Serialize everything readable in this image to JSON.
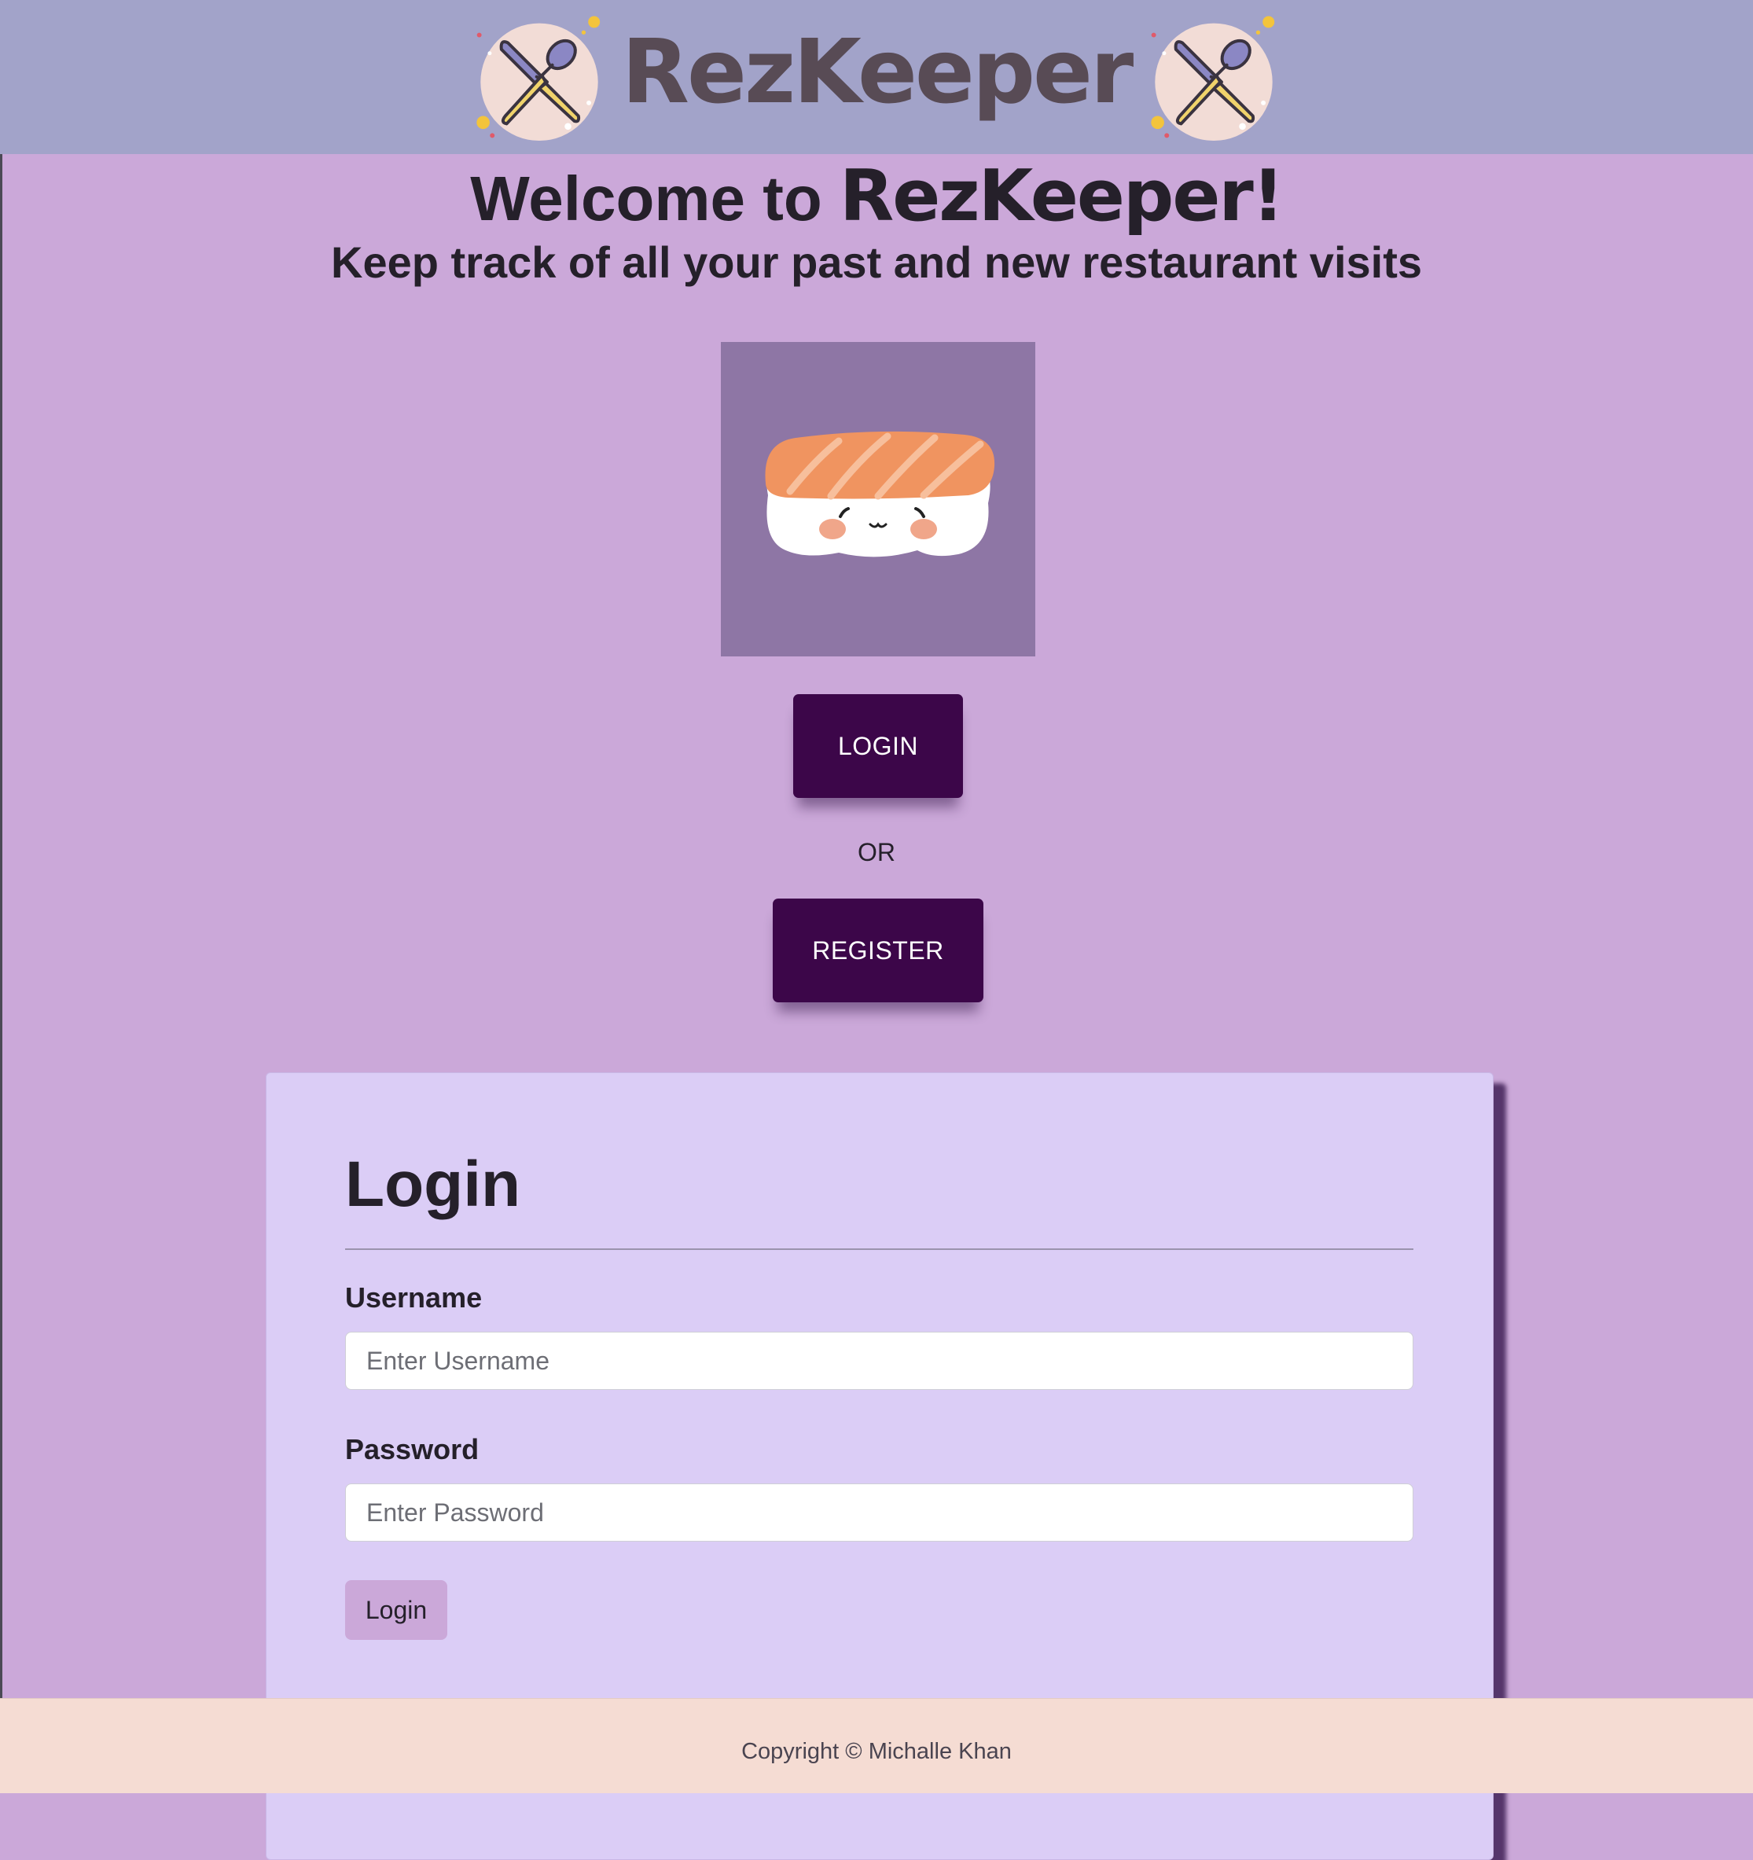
{
  "header": {
    "brand": "RezKeeper"
  },
  "hero": {
    "welcome_prefix": "Welcome to ",
    "welcome_brand": "RezKeeper!",
    "tagline": "Keep track of all your past and new restaurant visits"
  },
  "actions": {
    "login_label": "LOGIN",
    "or_label": "OR",
    "register_label": "REGISTER"
  },
  "login_form": {
    "title": "Login",
    "username_label": "Username",
    "username_placeholder": "Enter Username",
    "username_value": "",
    "password_label": "Password",
    "password_placeholder": "Enter Password",
    "password_value": "",
    "submit_label": "Login"
  },
  "footer": {
    "copyright": "Copyright © Michalle Khan"
  },
  "icons": {
    "logo_left": "crossed-knife-spoon-icon",
    "logo_right": "crossed-knife-spoon-icon",
    "hero_image": "sushi-illustration"
  },
  "colors": {
    "header_bg": "#a2a3c9",
    "page_bg": "#cba8d9",
    "button_bg": "#3c0649",
    "card_bg": "#dbcdf6",
    "footer_bg": "#f5dcd3"
  }
}
